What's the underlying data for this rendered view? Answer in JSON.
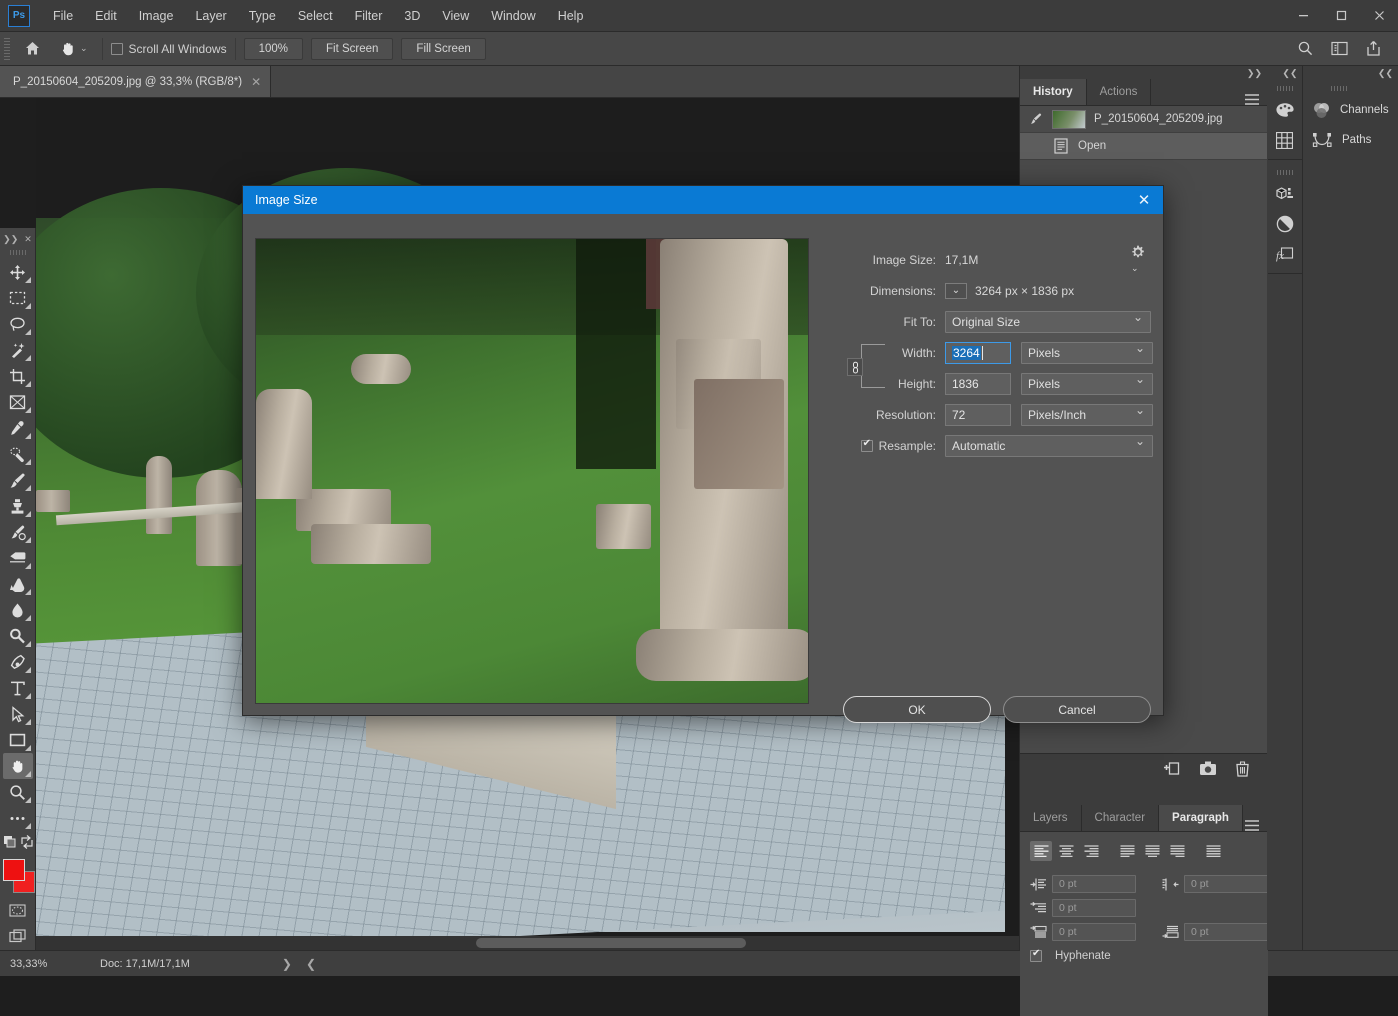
{
  "app": {
    "logo": "Ps"
  },
  "menubar": {
    "items": [
      "File",
      "Edit",
      "Image",
      "Layer",
      "Type",
      "Select",
      "Filter",
      "3D",
      "View",
      "Window",
      "Help"
    ]
  },
  "window_controls": {
    "minimize": "—",
    "maximize": "▢",
    "close": "✕"
  },
  "options_bar": {
    "home_icon": "home-icon",
    "tool_icon": "hand-tool-icon",
    "scroll_all_windows_label": "Scroll All Windows",
    "scroll_all_windows_checked": false,
    "buttons": [
      "100%",
      "Fit Screen",
      "Fill Screen"
    ],
    "right_icons": [
      "search-icon",
      "workspace-icon",
      "share-icon"
    ]
  },
  "document_tab": {
    "title": "P_20150604_205209.jpg @ 33,3% (RGB/8*)",
    "close": "✕"
  },
  "toolbar": {
    "tools": [
      {
        "name": "move-tool",
        "active": false
      },
      {
        "name": "rectangular-marquee-tool",
        "active": false
      },
      {
        "name": "lasso-tool",
        "active": false
      },
      {
        "name": "magic-wand-tool",
        "active": false
      },
      {
        "name": "crop-tool",
        "active": false
      },
      {
        "name": "frame-tool",
        "active": false
      },
      {
        "name": "eyedropper-tool",
        "active": false
      },
      {
        "name": "healing-brush-tool",
        "active": false
      },
      {
        "name": "brush-tool",
        "active": false
      },
      {
        "name": "clone-stamp-tool",
        "active": false
      },
      {
        "name": "history-brush-tool",
        "active": false
      },
      {
        "name": "eraser-tool",
        "active": false
      },
      {
        "name": "gradient-tool",
        "active": false
      },
      {
        "name": "blur-tool",
        "active": false
      },
      {
        "name": "dodge-tool",
        "active": false
      },
      {
        "name": "pen-tool",
        "active": false
      },
      {
        "name": "type-tool",
        "active": false
      },
      {
        "name": "path-selection-tool",
        "active": false
      },
      {
        "name": "rectangle-tool",
        "active": false
      },
      {
        "name": "hand-tool",
        "active": true
      },
      {
        "name": "zoom-tool",
        "active": false
      },
      {
        "name": "edit-toolbar-more",
        "active": false
      }
    ],
    "foreground_color": "#ee1111",
    "background_color": "#f02020"
  },
  "status_bar": {
    "zoom": "33,33%",
    "doc": "Doc: 17,1M/17,1M",
    "next_arrow": "❯",
    "prev_arrow": "❮"
  },
  "history_panel": {
    "tabs": [
      {
        "label": "History",
        "active": true
      },
      {
        "label": "Actions",
        "active": false
      }
    ],
    "menu_icon": "panel-menu-icon",
    "collapse_icon": "❯❯",
    "snapshot": {
      "label": "P_20150604_205209.jpg",
      "icon": "snapshot-brush-icon"
    },
    "states": [
      {
        "label": "Open",
        "icon": "open-document-icon",
        "selected": true
      }
    ],
    "footer_icons": [
      "new-document-icon",
      "new-snapshot-icon",
      "delete-icon"
    ]
  },
  "paragraph_panel": {
    "tabs": [
      {
        "label": "Layers",
        "active": false
      },
      {
        "label": "Character",
        "active": false
      },
      {
        "label": "Paragraph",
        "active": true
      }
    ],
    "menu_icon": "panel-menu-icon",
    "alignment": [
      {
        "name": "align-left",
        "active": true
      },
      {
        "name": "align-center",
        "active": false
      },
      {
        "name": "align-right",
        "active": false
      },
      {
        "name": "justify-last-left",
        "active": false
      },
      {
        "name": "justify-last-center",
        "active": false
      },
      {
        "name": "justify-last-right",
        "active": false
      },
      {
        "name": "justify-all",
        "active": false
      }
    ],
    "indent_left": "0 pt",
    "indent_right": "0 pt",
    "indent_first_line": "0 pt",
    "space_before": "0 pt",
    "space_after": "0 pt",
    "hyphenate_label": "Hyphenate",
    "hyphenate_checked": true
  },
  "dock": {
    "collapse_left": "❮❮",
    "collapse_right": "❮❮",
    "icons": [
      "color-swatches-icon",
      "grid-icon",
      "3d-icon",
      "adjustments-icon",
      "layer-styles-icon"
    ],
    "entries": [
      {
        "label": "Channels",
        "icon": "channels-icon"
      },
      {
        "label": "Paths",
        "icon": "paths-icon"
      }
    ]
  },
  "dialog": {
    "title": "Image Size",
    "close": "✕",
    "image_size_label": "Image Size:",
    "image_size_value": "17,1M",
    "gear_icon": "gear-icon",
    "dimensions_label": "Dimensions:",
    "dimensions_caret": "⌄",
    "dimensions_value": "3264 px  ×  1836 px",
    "fit_to_label": "Fit To:",
    "fit_to_value": "Original Size",
    "width_label": "Width:",
    "width_value": "3264",
    "width_unit": "Pixels",
    "height_label": "Height:",
    "height_value": "1836",
    "height_unit": "Pixels",
    "resolution_label": "Resolution:",
    "resolution_value": "72",
    "resolution_unit": "Pixels/Inch",
    "resample_label": "Resample:",
    "resample_checked": true,
    "resample_value": "Automatic",
    "link_icon": "chain-link-icon",
    "ok_label": "OK",
    "cancel_label": "Cancel",
    "title_bar_color": "#0a7ad4",
    "focus_color": "#3d9ae8"
  }
}
